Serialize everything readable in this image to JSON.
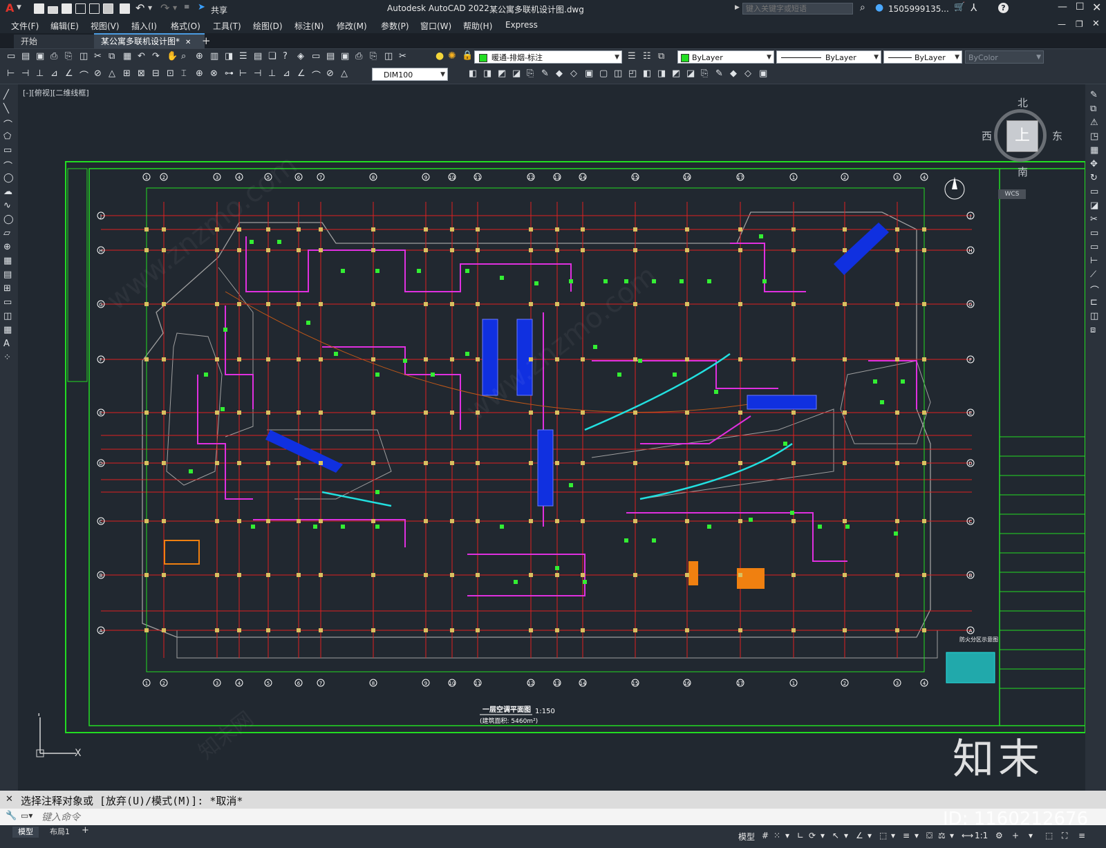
{
  "app": {
    "title": "Autodesk AutoCAD 2022",
    "document_title": "某公寓多联机设计图.dwg",
    "share_label": "共享",
    "search_placeholder": "键入关键字或短语",
    "user": "1505999135...",
    "logo_letter": "A"
  },
  "menu": [
    "文件(F)",
    "编辑(E)",
    "视图(V)",
    "插入(I)",
    "格式(O)",
    "工具(T)",
    "绘图(D)",
    "标注(N)",
    "修改(M)",
    "参数(P)",
    "窗口(W)",
    "帮助(H)",
    "Express"
  ],
  "tabs": [
    {
      "label": "开始",
      "active": false
    },
    {
      "label": "某公寓多联机设计图*",
      "active": true
    }
  ],
  "add_tab": "+",
  "toolbar": {
    "layer": "暖通-排烟-标注",
    "color": "ByLayer",
    "linetype": "ByLayer",
    "lineweight": "ByLayer",
    "plotstyle": "ByColor",
    "dimstyle": "DIM100"
  },
  "viewport_label": "[-][俯视][二维线框]",
  "viewcube": {
    "north": "北",
    "south": "南",
    "east": "东",
    "west": "西",
    "top": "上",
    "wcs": "WCS"
  },
  "drawing": {
    "title": "一层空调平面图",
    "scale": "1:150",
    "area": "(建筑面积: 5460m²)",
    "fire_zone": "防火分区示意图",
    "col_labels": [
      "1",
      "2",
      "3",
      "4",
      "5",
      "6",
      "7",
      "8",
      "9",
      "10",
      "11",
      "12",
      "13",
      "14",
      "15",
      "16",
      "17"
    ],
    "row_labels": [
      "J",
      "H",
      "G",
      "F",
      "E",
      "D",
      "C",
      "B",
      "A"
    ]
  },
  "command": {
    "history": "选择注释对象或 [放弃(U)/模式(M)]: *取消*",
    "placeholder": "键入命令"
  },
  "layout_tabs": [
    "模型",
    "布局1"
  ],
  "status": {
    "model": "模型",
    "scale": "1:1"
  },
  "watermark": {
    "site": "www.znzmo.com",
    "brand": "知末",
    "cn": "知末网",
    "id": "ID: 1160212676"
  },
  "colors": {
    "grid_red": "#e02020",
    "frame_green": "#22dd22",
    "pipe_magenta": "#e030e0",
    "wall_gray": "#a0a0a0",
    "unit_green": "#33ee33",
    "cyan": "#22e0e0",
    "blue": "#1030e0",
    "orange": "#f08010"
  }
}
